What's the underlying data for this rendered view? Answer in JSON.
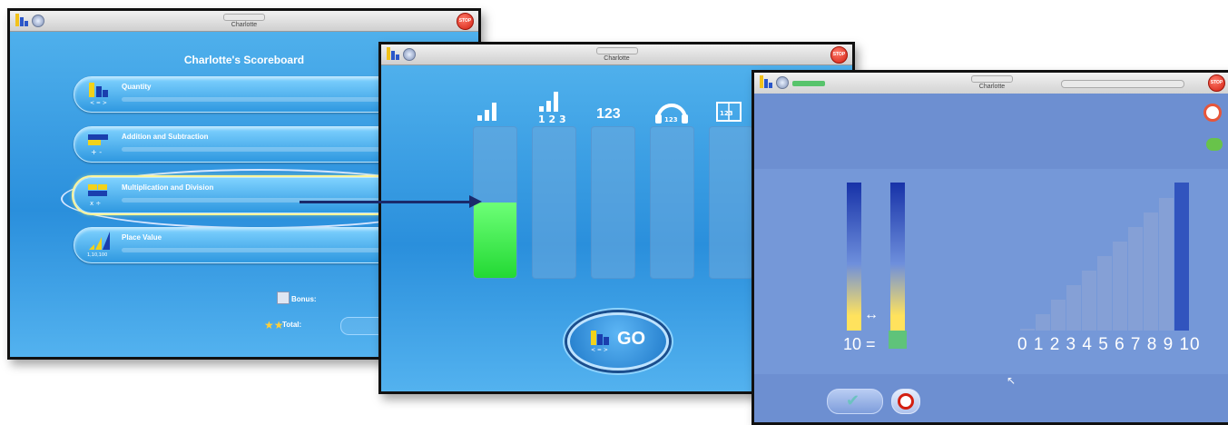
{
  "window1": {
    "user_name": "Charlotte",
    "stop_label": "STOP",
    "title": "Charlotte's Scoreboard",
    "categories": [
      {
        "label": "Quantity",
        "icon_caption": "< = >"
      },
      {
        "label": "Addition and Subtraction",
        "icon_caption": "+ -"
      },
      {
        "label": "Multiplication and Division",
        "icon_caption": "x ÷"
      },
      {
        "label": "Place Value",
        "icon_caption": "1,10,100"
      }
    ],
    "bonus_label": "Bonus:",
    "total_label": "Total:"
  },
  "window2": {
    "user_name": "Charlotte",
    "stop_label": "STOP",
    "levels": [
      {
        "icon": "bars-icon",
        "fill_percent": 50
      },
      {
        "icon": "bars-123-icon",
        "caption": "1 2 3",
        "fill_percent": 0
      },
      {
        "icon": "numbers-icon",
        "caption": "123",
        "fill_percent": 0
      },
      {
        "icon": "headphones-icon",
        "caption": "123",
        "fill_percent": 0
      },
      {
        "icon": "book-icon",
        "caption": "123",
        "fill_percent": 0
      }
    ],
    "go_label": "GO"
  },
  "window3": {
    "user_name": "Charlotte",
    "stop_label": "STOP",
    "equation_value": "10",
    "equals": "=",
    "number_line": "0 1 2 3 4 5 6 7 8 9 10",
    "arrow_symbol": "↔"
  },
  "colors": {
    "blue_bg": "#2a8fdc",
    "green_fill": "#23d934",
    "stop_red": "#d31f10",
    "exercise_bg": "#6d8fd1"
  }
}
